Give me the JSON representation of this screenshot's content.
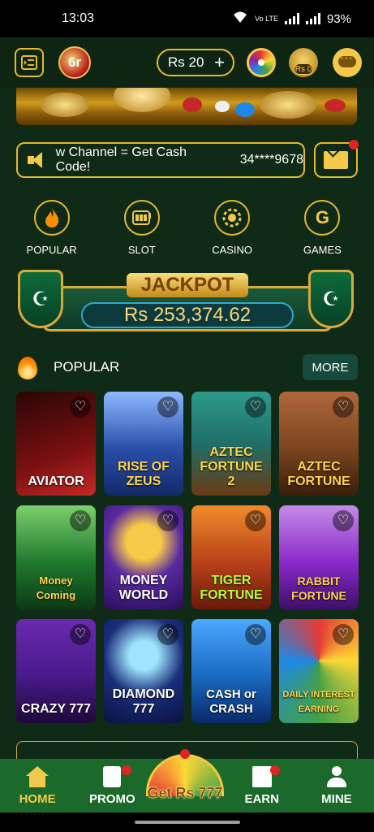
{
  "status_bar": {
    "time": "13:03",
    "network": "Vo LTE",
    "battery": "93%"
  },
  "header": {
    "logo_text": "6r",
    "balance": "Rs 20",
    "bag_label": "Rs 0"
  },
  "marquee": {
    "text": "w Channel = Get Cash Code!",
    "phone": "34****9678"
  },
  "categories": [
    {
      "label": "POPULAR",
      "icon": "fire-icon"
    },
    {
      "label": "SLOT",
      "icon": "slot-machine-icon"
    },
    {
      "label": "CASINO",
      "icon": "chip-icon"
    },
    {
      "label": "GAMES",
      "icon": "g-letter-icon",
      "glyph": "G"
    }
  ],
  "jackpot": {
    "title": "JACKPOT",
    "amount": "Rs 253,374.62"
  },
  "section": {
    "title": "POPULAR",
    "more_label": "MORE"
  },
  "games": [
    {
      "name": "AVIATOR",
      "color": "#7a1010"
    },
    {
      "name": "RISE OF ZEUS",
      "color": "#2a4fa8"
    },
    {
      "name": "AZTEC FORTUNE 2",
      "color": "#1f6f6a"
    },
    {
      "name": "AZTEC FORTUNE",
      "color": "#7a4520"
    },
    {
      "name": "Money Coming",
      "color": "#1f7a2e"
    },
    {
      "name": "MONEY WORLD",
      "color": "#5a2aa0"
    },
    {
      "name": "TIGER FORTUNE",
      "color": "#b8421a"
    },
    {
      "name": "RABBIT FORTUNE",
      "color": "#8a2ac8"
    },
    {
      "name": "CRAZY 777",
      "color": "#4a1a8a"
    },
    {
      "name": "DIAMOND 777",
      "color": "#1a2e7a"
    },
    {
      "name": "CASH or CRASH",
      "color": "#1a6ac0"
    },
    {
      "name": "DAILY INTEREST EARNING",
      "color": "#2e6a3a"
    }
  ],
  "bottom_nav": {
    "home": "HOME",
    "promo": "PROMO",
    "center": "Get Rs 777",
    "earn": "EARN",
    "mine": "MINE"
  },
  "colors": {
    "background": "#0f2a16",
    "accent_gold": "#e7b92e",
    "nav_green": "#1b6a2b",
    "badge_red": "#e02424"
  }
}
